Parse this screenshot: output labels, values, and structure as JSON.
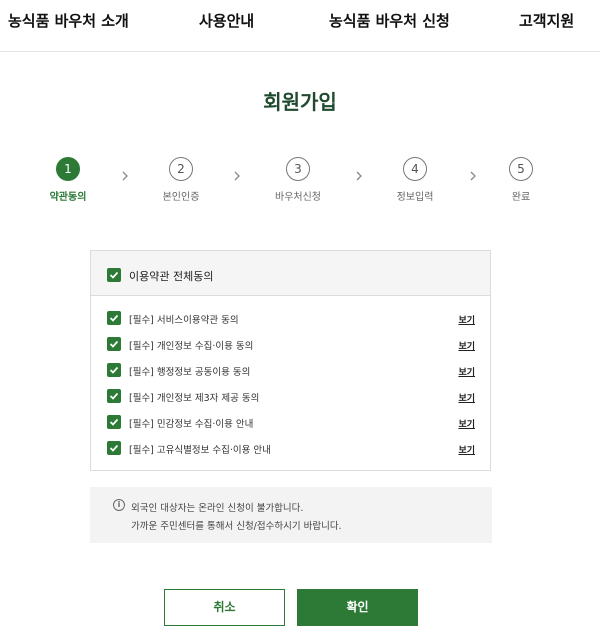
{
  "nav": {
    "items": [
      "농식품 바우처 소개",
      "사용안내",
      "농식품 바우처 신청",
      "고객지원"
    ]
  },
  "page_title": "회원가입",
  "steps": [
    {
      "num": "1",
      "label": "약관동의"
    },
    {
      "num": "2",
      "label": "본인인증"
    },
    {
      "num": "3",
      "label": "바우처신청"
    },
    {
      "num": "4",
      "label": "정보입력"
    },
    {
      "num": "5",
      "label": "완료"
    }
  ],
  "terms": {
    "all_label": "이용약관 전체동의",
    "view_label": "보기",
    "items": [
      "[필수] 서비스이용약관 동의",
      "[필수] 개인정보 수집·이용 동의",
      "[필수] 행정정보 공동이용 동의",
      "[필수] 개인정보 제3자 제공 동의",
      "[필수] 민감정보 수집·이용 안내",
      "[필수] 고유식별정보 수집·이용 안내"
    ]
  },
  "notice": {
    "icon": "info-icon",
    "line1": "외국인 대상자는 온라인 신청이 불가합니다.",
    "line2": "가까운 주민센터를 통해서 신청/접수하시기 바랍니다."
  },
  "buttons": {
    "cancel": "취소",
    "confirm": "확인"
  },
  "colors": {
    "accent": "#2c7a36",
    "title": "#1f4a2e"
  }
}
